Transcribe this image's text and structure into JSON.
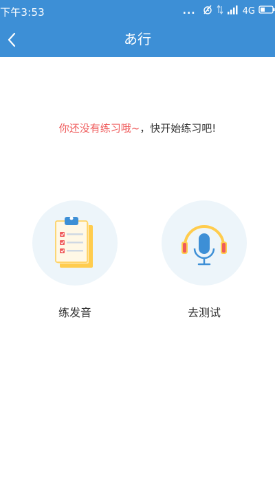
{
  "status_bar": {
    "time": "下午3:53",
    "dots": "...",
    "network": "4G"
  },
  "nav": {
    "title": "あ行"
  },
  "message": {
    "highlight": "你还没有练习哦~",
    "rest": "，快开始练习吧!"
  },
  "actions": [
    {
      "label": "练发音",
      "icon": "clipboard-checklist-icon"
    },
    {
      "label": "去测试",
      "icon": "headphones-microphone-icon"
    }
  ],
  "colors": {
    "primary": "#3d8fd6",
    "highlight": "#ef5b5b",
    "circle_bg": "#edf5fa"
  }
}
